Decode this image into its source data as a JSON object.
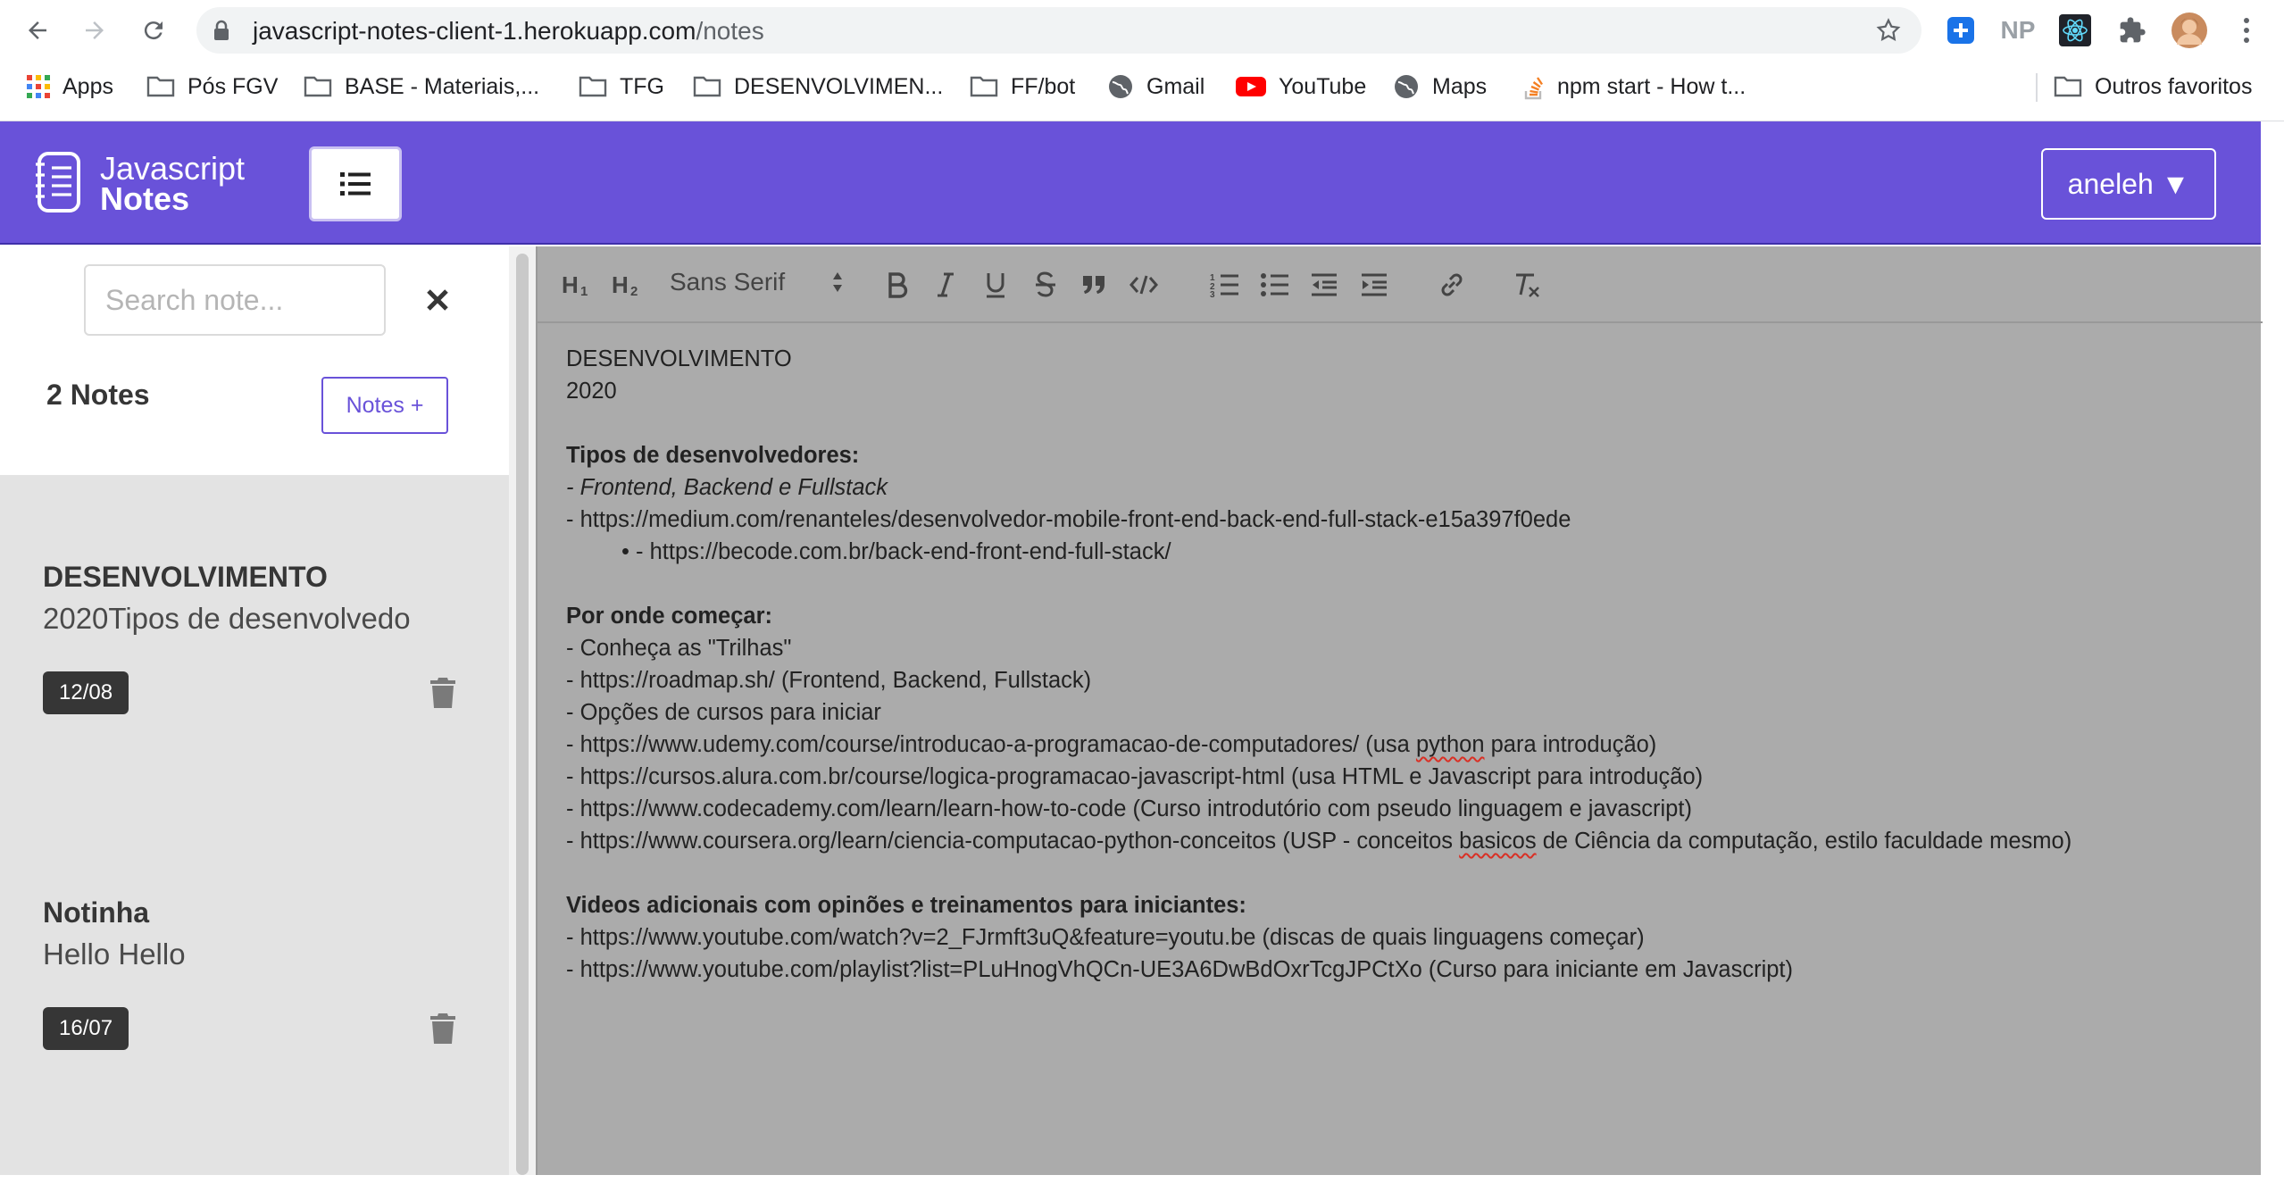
{
  "browser": {
    "url_host": "javascript-notes-client-1.herokuapp.com",
    "url_path": "/notes",
    "bookmarks": [
      {
        "label": "Apps",
        "icon": "apps-grid-icon"
      },
      {
        "label": "Pós FGV",
        "icon": "folder-icon"
      },
      {
        "label": "BASE - Materiais,...",
        "icon": "folder-icon"
      },
      {
        "label": "TFG",
        "icon": "folder-icon"
      },
      {
        "label": "DESENVOLVIMEN...",
        "icon": "folder-icon"
      },
      {
        "label": "FF/bot",
        "icon": "folder-icon"
      },
      {
        "label": "Gmail",
        "icon": "globe-icon"
      },
      {
        "label": "YouTube",
        "icon": "youtube-icon"
      },
      {
        "label": "Maps",
        "icon": "globe-icon"
      },
      {
        "label": "npm start - How t...",
        "icon": "stackoverflow-icon"
      },
      {
        "label": "Outros favoritos",
        "icon": "folder-icon"
      }
    ],
    "extensions": [
      "NP"
    ]
  },
  "app": {
    "logo_line1": "Javascript",
    "logo_line2": "Notes",
    "user_menu": "aneleh ▼",
    "brand_color": "#6952d9"
  },
  "sidebar": {
    "search_placeholder": "Search note...",
    "notes_count": "2 Notes",
    "new_note_label": "Notes +",
    "notes": [
      {
        "title": "DESENVOLVIMENTO",
        "preview": "2020Tipos de desenvolvedo",
        "date": "12/08"
      },
      {
        "title": "Notinha",
        "preview": "Hello Hello",
        "date": "16/07"
      }
    ]
  },
  "editor": {
    "toolbar": {
      "h1": "H1",
      "h2": "H2",
      "font": "Sans Serif"
    },
    "content": {
      "l1": "DESENVOLVIMENTO",
      "l2": "2020",
      "h_tipos": "Tipos de desenvolvedores:",
      "tipos_1": "- Frontend, Backend e Fullstack",
      "tipos_2": "- https://medium.com/renanteles/desenvolvedor-mobile-front-end-back-end-full-stack-e15a397f0ede",
      "tipos_3": "• - https://becode.com.br/back-end-front-end-full-stack/",
      "h_comecar": "Por onde começar:",
      "c1": "- Conheça as \"Trilhas\"",
      "c2": "- https://roadmap.sh/ (Frontend, Backend, Fullstack)",
      "c3": "- Opções de cursos para iniciar",
      "c4a": "- https://www.udemy.com/course/introducao-a-programacao-de-computadores/ (usa ",
      "c4b": "python",
      "c4c": " para introdução)",
      "c5": "- https://cursos.alura.com.br/course/logica-programacao-javascript-html (usa HTML e Javascript para introdução)",
      "c6": "- https://www.codecademy.com/learn/learn-how-to-code (Curso introdutório com pseudo linguagem e javascript)",
      "c7a": "- https://www.coursera.org/learn/ciencia-computacao-python-conceitos (USP - conceitos ",
      "c7b": "basicos",
      "c7c": " de Ciência da computação, estilo faculdade mesmo)",
      "h_videos": "Videos adicionais com opinões e treinamentos para iniciantes:",
      "v1": "- https://www.youtube.com/watch?v=2_FJrmft3uQ&feature=youtu.be (discas de quais linguagens começar)",
      "v2": "- https://www.youtube.com/playlist?list=PLuHnogVhQCn-UE3A6DwBdOxrTcgJPCtXo (Curso para iniciante em Javascript)"
    }
  }
}
